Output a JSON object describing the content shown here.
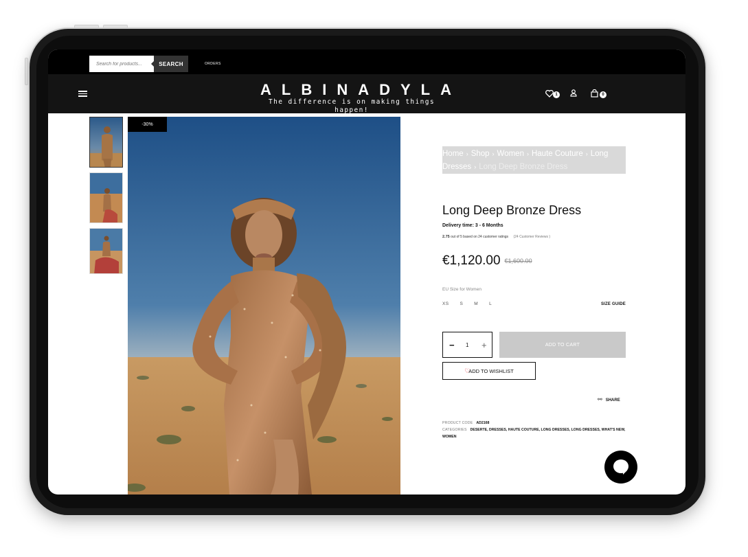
{
  "topbar": {
    "search_placeholder": "Search for products...",
    "search_button": "SEARCH",
    "orders": "ORDERS"
  },
  "header": {
    "logo": "ALBINADYLA",
    "tagline": "The difference is on making things happen!",
    "wishlist_count": "1",
    "cart_count": "0"
  },
  "product": {
    "sale_badge": "-30%",
    "breadcrumb": [
      "Home",
      "Shop",
      "Women",
      "Haute Couture",
      "Long Dresses",
      "Long Deep Bronze Dress"
    ],
    "title": "Long Deep Bronze Dress",
    "delivery": "Delivery time: 3 - 6 Months",
    "rating_value": "2.75",
    "rating_text": "out of 5 based on 24 customer ratings",
    "reviews": "(24 Customer Reviews )",
    "price": "€1,120.00",
    "price_old": "€1,600.00",
    "size_label": "EU Size for Women",
    "sizes": [
      "XS",
      "S",
      "M",
      "L"
    ],
    "size_guide": "SIZE GUIDE",
    "qty_minus": "−",
    "quantity": "1",
    "qty_plus": "+",
    "add_to_cart": "ADD TO CART",
    "wishlist": "ADD TO WISHLIST",
    "share": "SHARE",
    "product_code_label": "PRODUCT CODE",
    "product_code": "AD2168",
    "categories_label": "CATEGORIES",
    "categories": "DESERTE, DRESSES, HAUTE COUTURE, LONG DRESSES, LONG DRESSES, WHAT'S NEW, WOMEN"
  },
  "colors": {
    "topbar": "#000000",
    "header": "#141414",
    "add_to_cart_bg": "#c9c9c9",
    "breadcrumb_bg": "#d9d9d9",
    "heart": "#e01d2c"
  }
}
